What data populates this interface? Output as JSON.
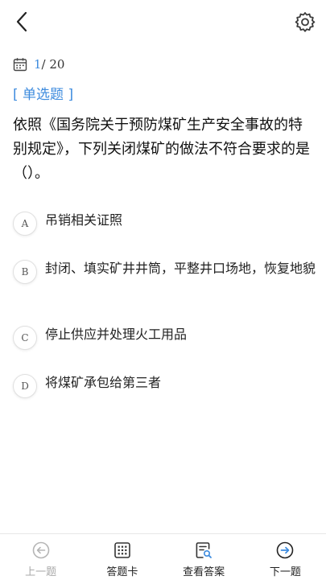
{
  "progress": {
    "current": "1",
    "total": "/ 20"
  },
  "question": {
    "type_label": "[ 单选题 ]",
    "text": "依照《国务院关于预防煤矿生产安全事故的特别规定》，下列关闭煤矿的做法不符合要求的是（）。"
  },
  "options": [
    {
      "letter": "A",
      "text": "吊销相关证照"
    },
    {
      "letter": "B",
      "text": "封闭、填实矿井井筒，平整井口场地，恢复地貌"
    },
    {
      "letter": "C",
      "text": "停止供应并处理火工用品"
    },
    {
      "letter": "D",
      "text": "将煤矿承包给第三者"
    }
  ],
  "bottom_nav": {
    "prev": "上一题",
    "answer_card": "答题卡",
    "view_answer": "查看答案",
    "next": "下一题"
  },
  "colors": {
    "accent": "#3d8bde",
    "disabled": "#a9a9a9",
    "text": "#222222"
  },
  "icons": {
    "back": "chevron-left-icon",
    "settings": "gear-icon",
    "progress": "calendar-icon",
    "prev": "arrow-left-circle-icon",
    "answer_card": "grid-icon",
    "view_answer": "document-search-icon",
    "next": "arrow-right-circle-icon"
  }
}
